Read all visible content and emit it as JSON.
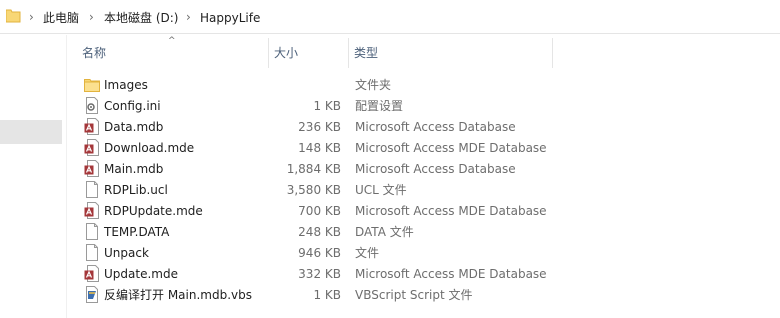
{
  "breadcrumb": {
    "items": [
      "此电脑",
      "本地磁盘 (D:)",
      "HappyLife"
    ]
  },
  "columns": {
    "name": "名称",
    "size": "大小",
    "type": "类型"
  },
  "files": [
    {
      "name": "Images",
      "size": "",
      "type": "文件夹",
      "icon": "folder-icon"
    },
    {
      "name": "Config.ini",
      "size": "1 KB",
      "type": "配置设置",
      "icon": "settings-file-icon"
    },
    {
      "name": "Data.mdb",
      "size": "236 KB",
      "type": "Microsoft Access Database",
      "icon": "access-db-icon"
    },
    {
      "name": "Download.mde",
      "size": "148 KB",
      "type": "Microsoft Access MDE Database",
      "icon": "access-db-icon"
    },
    {
      "name": "Main.mdb",
      "size": "1,884 KB",
      "type": "Microsoft Access Database",
      "icon": "access-db-icon"
    },
    {
      "name": "RDPLib.ucl",
      "size": "3,580 KB",
      "type": "UCL 文件",
      "icon": "blank-file-icon"
    },
    {
      "name": "RDPUpdate.mde",
      "size": "700 KB",
      "type": "Microsoft Access MDE Database",
      "icon": "access-db-icon"
    },
    {
      "name": "TEMP.DATA",
      "size": "248 KB",
      "type": "DATA 文件",
      "icon": "blank-file-icon"
    },
    {
      "name": "Unpack",
      "size": "946 KB",
      "type": "文件",
      "icon": "blank-file-icon"
    },
    {
      "name": "Update.mde",
      "size": "332 KB",
      "type": "Microsoft Access MDE Database",
      "icon": "access-db-icon"
    },
    {
      "name": "反编译打开 Main.mdb.vbs",
      "size": "1 KB",
      "type": "VBScript Script 文件",
      "icon": "vbscript-file-icon"
    }
  ]
}
